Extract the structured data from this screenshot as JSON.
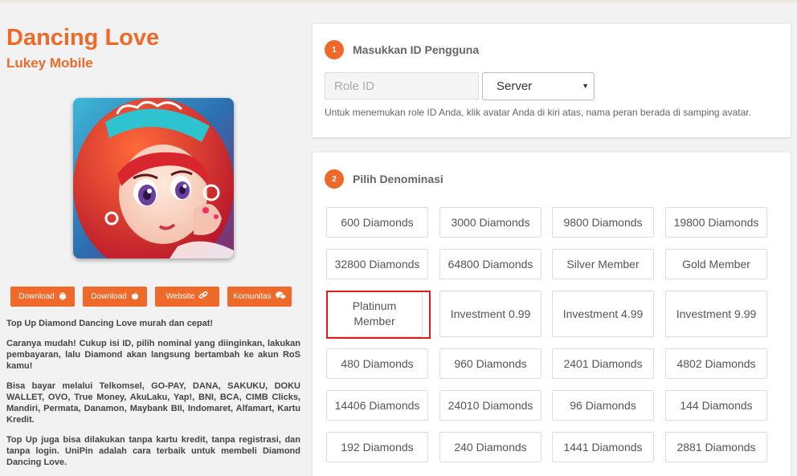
{
  "game": {
    "title": "Dancing Love",
    "publisher": "Lukey Mobile",
    "image_alt": "game-cover-art"
  },
  "links": [
    {
      "label": "Download",
      "icon": "android-icon"
    },
    {
      "label": "Download",
      "icon": "apple-icon"
    },
    {
      "label": "Website",
      "icon": "link-icon"
    },
    {
      "label": "Komunitas",
      "icon": "chat-icon"
    }
  ],
  "description": [
    "Top Up Diamond Dancing Love murah dan cepat!",
    "Caranya mudah! Cukup isi ID, pilih nominal yang diinginkan, lakukan pembayaran, lalu Diamond akan langsung bertambah ke akun RoS kamu!",
    "Bisa bayar melalui Telkomsel, GO-PAY, DANA, SAKUKU, DOKU WALLET, OVO, True Money, AkuLaku, Yap!, BNI, BCA, CIMB Clicks, Mandiri, Permata, Danamon, Maybank BII, Indomaret, Alfamart, Kartu Kredit.",
    "Top Up juga bisa dilakukan tanpa kartu kredit, tanpa registrasi, dan tanpa login. UniPin adalah cara terbaik untuk membeli Diamond Dancing Love."
  ],
  "step1": {
    "number": "1",
    "title": "Masukkan ID Pengguna",
    "role_placeholder": "Role ID",
    "role_value": "",
    "server_selected": "Server",
    "help": "Untuk menemukan role ID Anda, klik avatar Anda di kiri atas, nama peran berada di samping avatar."
  },
  "step2": {
    "number": "2",
    "title": "Pilih Denominasi",
    "denominations": [
      "600 Diamonds",
      "3000 Diamonds",
      "9800 Diamonds",
      "19800 Diamonds",
      "32800 Diamonds",
      "64800 Diamonds",
      "Silver Member",
      "Gold Member",
      "Platinum Member",
      "Investment 0.99",
      "Investment 4.99",
      "Investment 9.99",
      "480 Diamonds",
      "960 Diamonds",
      "2401 Diamonds",
      "4802 Diamonds",
      "14406 Diamonds",
      "24010 Diamonds",
      "96 Diamonds",
      "144 Diamonds",
      "192 Diamonds",
      "240 Diamonds",
      "1441 Diamonds",
      "2881 Diamonds"
    ],
    "highlighted": "Platinum Member"
  },
  "colors": {
    "accent": "#ef6a2a",
    "highlight": "#e01b1b",
    "background": "#f2f2f2"
  }
}
